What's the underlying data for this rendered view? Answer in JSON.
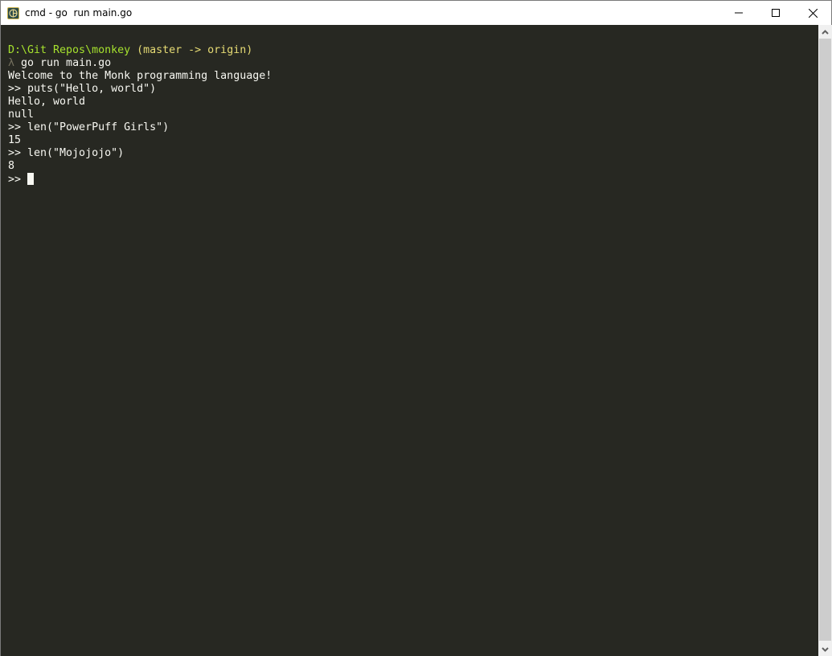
{
  "window": {
    "title": "cmd - go  run main.go",
    "icon": "cmder-icon",
    "controls": [
      "minimize-icon",
      "maximize-icon",
      "close-icon"
    ]
  },
  "terminal": {
    "prompt_path": "D:\\Git Repos\\monkey",
    "prompt_branch": " (master -> origin)",
    "lambda": "λ",
    "command": " go run main.go",
    "lines": [
      "Welcome to the Monk programming language!",
      ">> puts(\"Hello, world\")",
      "Hello, world",
      "null",
      ">> len(\"PowerPuff Girls\")",
      "15",
      ">> len(\"Mojojojo\")",
      "8"
    ],
    "current_prompt": ">> ",
    "colors": {
      "background": "#272822",
      "foreground": "#f8f8f2",
      "path": "#a6e22e",
      "branch": "#e6db74"
    }
  },
  "scrollbar": {
    "visible_fraction": 1.0,
    "position": 0
  }
}
